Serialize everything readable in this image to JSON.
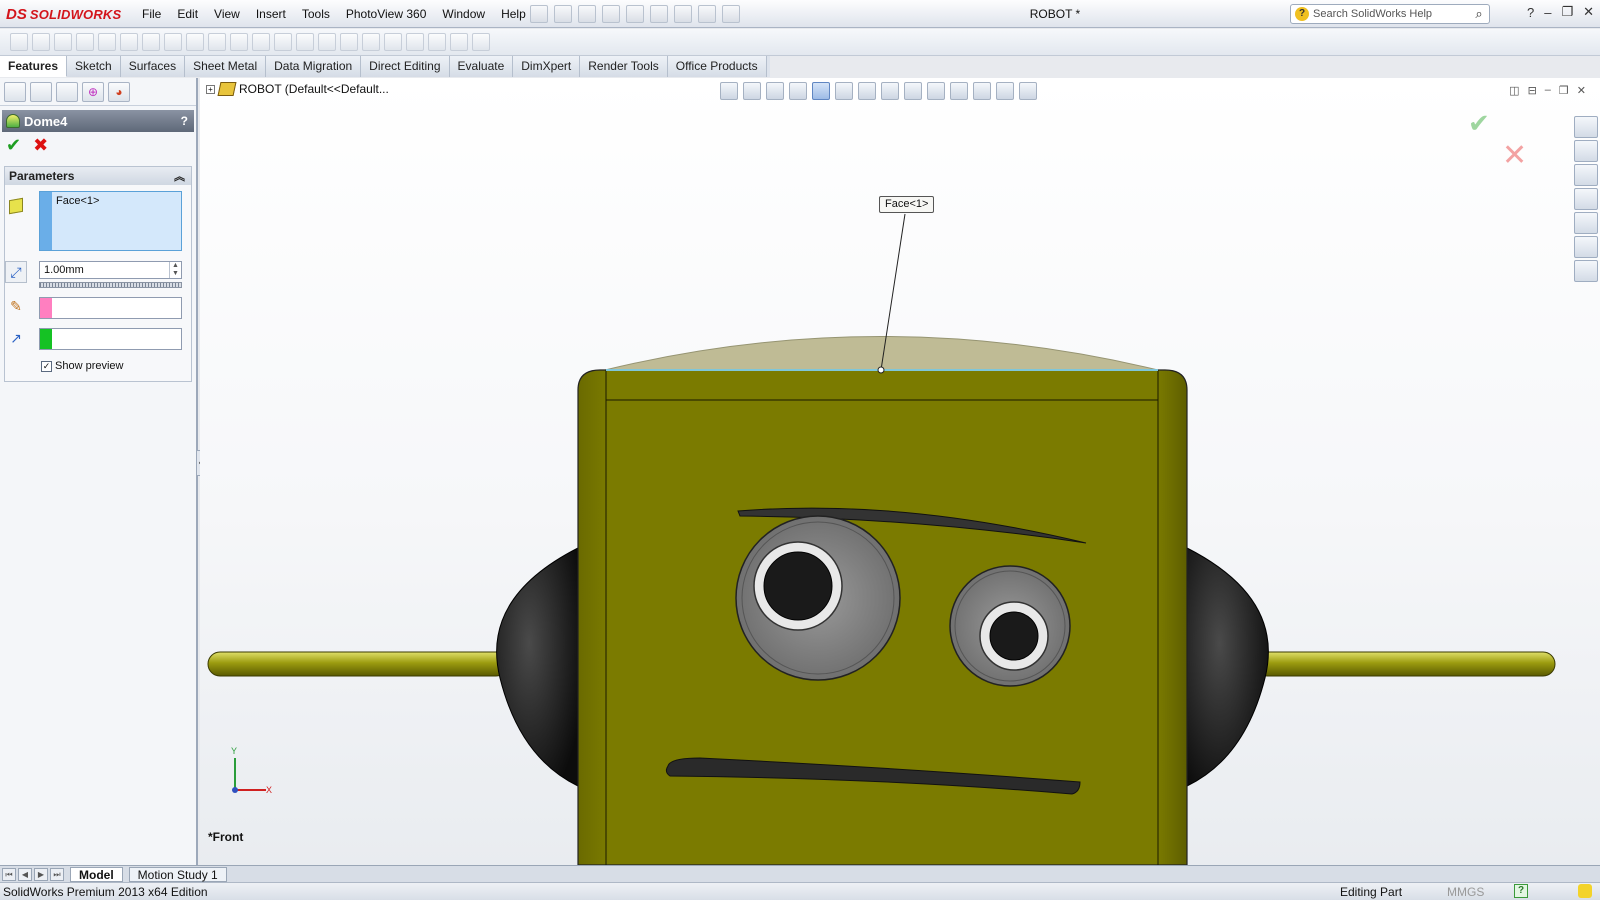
{
  "app": {
    "logo_mark": "DS",
    "logo_name": "SOLIDWORKS",
    "doc_title": "ROBOT *"
  },
  "menu": [
    "File",
    "Edit",
    "View",
    "Insert",
    "Tools",
    "PhotoView 360",
    "Window",
    "Help"
  ],
  "search": {
    "placeholder": "Search SolidWorks Help"
  },
  "tabs": [
    {
      "label": "Features",
      "active": true
    },
    {
      "label": "Sketch"
    },
    {
      "label": "Surfaces"
    },
    {
      "label": "Sheet Metal"
    },
    {
      "label": "Data Migration"
    },
    {
      "label": "Direct Editing"
    },
    {
      "label": "Evaluate"
    },
    {
      "label": "DimXpert"
    },
    {
      "label": "Render Tools"
    },
    {
      "label": "Office Products"
    }
  ],
  "property_manager": {
    "title": "Dome4",
    "help": "?",
    "ok": "✔",
    "cancel": "✖",
    "section": "Parameters",
    "faces_value": "Face<1>",
    "distance_value": "1.00mm",
    "preview_label": "Show preview",
    "preview_checked": true
  },
  "tree": {
    "root_label": "ROBOT  (Default<<Default..."
  },
  "viewport": {
    "callout": "Face<1>",
    "view_name": "*Front",
    "axis_y": "Y",
    "axis_x": "X",
    "colors": {
      "body": "#7a7a00",
      "body_dark": "#5f5f00",
      "dome": "#b8b48a",
      "ear": "#202020",
      "eye": "#8a8a8a"
    }
  },
  "bottom_tabs": [
    {
      "label": "Model",
      "active": true
    },
    {
      "label": "Motion Study 1"
    }
  ],
  "status": {
    "edition": "SolidWorks Premium 2013 x64 Edition",
    "mode": "Editing Part",
    "units": "MMGS"
  }
}
